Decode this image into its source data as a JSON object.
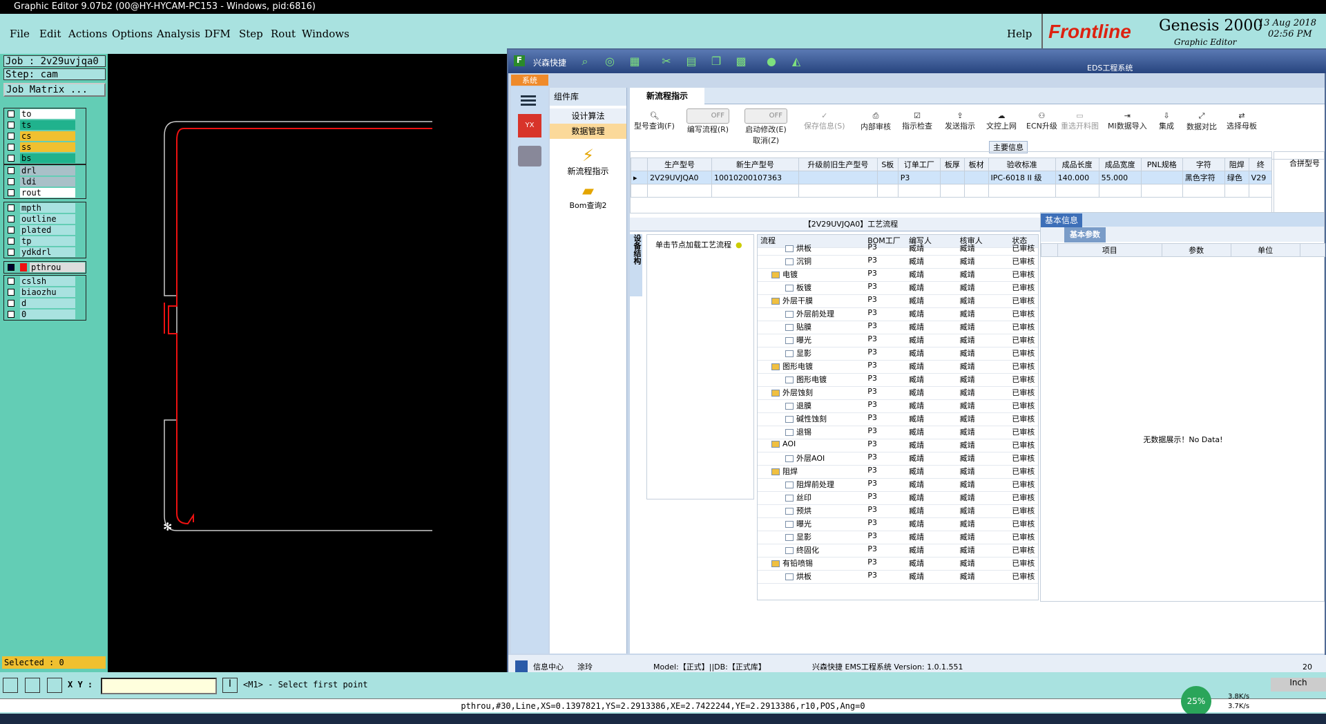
{
  "window": {
    "title": "Graphic Editor 9.07b2 (00@HY-HYCAM-PC153 - Windows, pid:6816)"
  },
  "ge_menu": [
    "File",
    "Edit",
    "Actions",
    "Options",
    "Analysis",
    "DFM",
    "Step",
    "Rout",
    "Windows"
  ],
  "ge_help": "Help",
  "logo": {
    "brand": "Frontline",
    "product": "Genesis 2000",
    "subtitle": "Graphic Editor",
    "date": "13 Aug 2018",
    "time": "02:56 PM"
  },
  "job": {
    "job_label": "Job : 2v29uvjqa0",
    "step_label": "Step: cam",
    "matrix_button": "Job Matrix ..."
  },
  "layers_group1": [
    {
      "name": "to",
      "color": "#ffffff"
    },
    {
      "name": "ts",
      "color": "#20b28d"
    },
    {
      "name": "cs",
      "color": "#f0c030"
    },
    {
      "name": "ss",
      "color": "#f0c030"
    },
    {
      "name": "bs",
      "color": "#20b28d"
    }
  ],
  "layers_group2": [
    {
      "name": "drl",
      "color": "#a9c0c8"
    },
    {
      "name": "ldi",
      "color": "#a9c0c8"
    },
    {
      "name": "rout",
      "color": "#ffffff"
    }
  ],
  "layers_group3": [
    {
      "name": "mpth",
      "color": "#a9e2e0"
    },
    {
      "name": "outline",
      "color": "#a9e2e0"
    },
    {
      "name": "plated",
      "color": "#a9e2e0"
    },
    {
      "name": "tp",
      "color": "#a9e2e0"
    },
    {
      "name": "ydkdrl",
      "color": "#a9e2e0"
    }
  ],
  "layer_active": "pthrou",
  "layers_group4": [
    {
      "name": "cslsh",
      "color": "#a9e2e0"
    },
    {
      "name": "biaozhu",
      "color": "#a9e2e0"
    },
    {
      "name": "d",
      "color": "#a9e2e0"
    },
    {
      "name": "0",
      "color": "#a9e2e0"
    }
  ],
  "selected": "Selected : 0",
  "coord_label": "X Y :",
  "prompt": "<M1> - Select first point",
  "status_line": "pthrou,#30,Line,XS=0.1397821,YS=2.2913386,XE=2.7422244,YE=2.2913386,r10,POS,Ang=0",
  "units": "Inch",
  "net": {
    "percent": "25%",
    "up": "3.8K/s",
    "down": "3.7K/s"
  },
  "ws": {
    "app_title": "兴森快捷",
    "overlay": "EDS工程系统",
    "system_tab": "系统",
    "comp_header": "组件库",
    "comp_items": [
      "设计算法",
      "数据管理"
    ],
    "comp_icons": [
      {
        "label": "新流程指示"
      },
      {
        "label": "Bom查询2"
      }
    ],
    "tab_label": "新流程指示",
    "toolbar": [
      "型号查询(F)",
      "编写流程(R)",
      "启动修改(E)",
      "保存信息(S)",
      "内部审核",
      "指示检查",
      "发送指示",
      "文控上网",
      "ECN升级",
      "重选开料图",
      "MI数据导入",
      "集成",
      "数据对比",
      "选择母板"
    ],
    "toggle_off": "OFF",
    "cancel_label": "取消(Z)",
    "main_info": "主要信息",
    "merge_label": "合拼型号",
    "grid_headers": [
      "生产型号",
      "新生产型号",
      "升级前旧生产型号",
      "S板",
      "订单工厂",
      "板厚",
      "板材",
      "验收标准",
      "成品长度",
      "成品宽度",
      "PNL规格",
      "字符",
      "阻焊",
      "终"
    ],
    "grid_row": [
      "2V29UVJQA0",
      "10010200107363",
      "",
      "",
      "P3",
      "",
      "",
      "IPC-6018 II 级",
      "140.000",
      "55.000",
      "",
      "黑色字符",
      "绿色",
      "V29"
    ],
    "process_title": "【2V29UVJQA0】工艺流程",
    "side_tab": "设备结构",
    "load_hint": "单击节点加载工艺流程",
    "proc_headers": [
      "流程",
      "BOM工厂",
      "编写人",
      "核审人",
      "状态"
    ],
    "proc_rows": [
      {
        "name": "烘板",
        "level": 2,
        "folder": false
      },
      {
        "name": "沉铜",
        "level": 2,
        "folder": false
      },
      {
        "name": "电镀",
        "level": 1,
        "folder": true
      },
      {
        "name": "板镀",
        "level": 2,
        "folder": false
      },
      {
        "name": "外层干膜",
        "level": 1,
        "folder": true
      },
      {
        "name": "外层前处理",
        "level": 2,
        "folder": false
      },
      {
        "name": "贴膜",
        "level": 2,
        "folder": false
      },
      {
        "name": "曝光",
        "level": 2,
        "folder": false
      },
      {
        "name": "显影",
        "level": 2,
        "folder": false
      },
      {
        "name": "图形电镀",
        "level": 1,
        "folder": true
      },
      {
        "name": "图形电镀",
        "level": 2,
        "folder": false
      },
      {
        "name": "外层蚀刻",
        "level": 1,
        "folder": true
      },
      {
        "name": "退膜",
        "level": 2,
        "folder": false
      },
      {
        "name": "碱性蚀刻",
        "level": 2,
        "folder": false
      },
      {
        "name": "退锡",
        "level": 2,
        "folder": false
      },
      {
        "name": "AOI",
        "level": 1,
        "folder": true
      },
      {
        "name": "外层AOI",
        "level": 2,
        "folder": false
      },
      {
        "name": "阻焊",
        "level": 1,
        "folder": true
      },
      {
        "name": "阻焊前处理",
        "level": 2,
        "folder": false
      },
      {
        "name": "丝印",
        "level": 2,
        "folder": false
      },
      {
        "name": "预烘",
        "level": 2,
        "folder": false
      },
      {
        "name": "曝光",
        "level": 2,
        "folder": false
      },
      {
        "name": "显影",
        "level": 2,
        "folder": false
      },
      {
        "name": "终固化",
        "level": 2,
        "folder": false
      },
      {
        "name": "有铅喷锡",
        "level": 1,
        "folder": true
      },
      {
        "name": "烘板",
        "level": 2,
        "folder": false
      }
    ],
    "proc_factory": "P3",
    "proc_writer": "臧靖",
    "proc_reviewer": "臧靖",
    "proc_status": "已审核",
    "basic_info": "基本信息",
    "basic_params": "基本参数",
    "param_headers": [
      "项目",
      "参数",
      "单位"
    ],
    "no_data": "无数据展示！No Data!",
    "status_bar": {
      "info_center": "信息中心",
      "user": "涂玲",
      "model": "Model:【正式】||DB:【正式库】",
      "company": "兴森快捷 EMS工程系统 Version: 1.0.1.551",
      "time": "20"
    }
  }
}
